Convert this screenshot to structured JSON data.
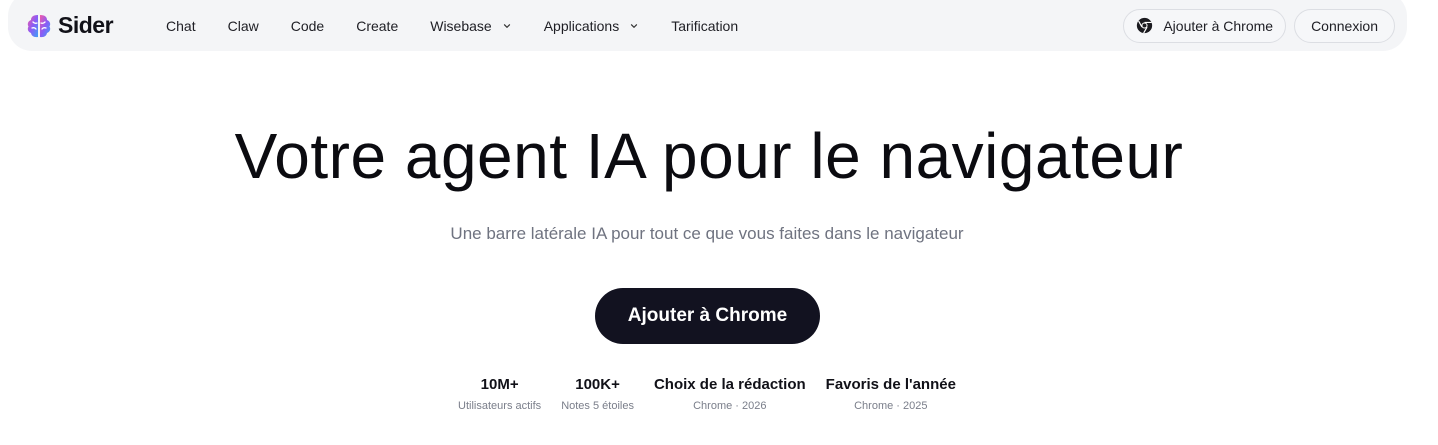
{
  "brand": {
    "name": "Sider",
    "logo_icon": "brain-icon"
  },
  "nav": {
    "items": [
      {
        "label": "Chat",
        "dropdown": false
      },
      {
        "label": "Claw",
        "dropdown": false
      },
      {
        "label": "Code",
        "dropdown": false
      },
      {
        "label": "Create",
        "dropdown": false
      },
      {
        "label": "Wisebase",
        "dropdown": true
      },
      {
        "label": "Applications",
        "dropdown": true
      },
      {
        "label": "Tarification",
        "dropdown": false
      }
    ],
    "add_chrome_label": "Ajouter à Chrome",
    "login_label": "Connexion"
  },
  "hero": {
    "title": "Votre agent IA pour le navigateur",
    "subtitle": "Une barre latérale IA pour tout ce que vous faites dans le navigateur",
    "cta_label": "Ajouter à Chrome"
  },
  "stats": [
    {
      "value": "10M+",
      "label": "Utilisateurs actifs"
    },
    {
      "value": "100K+",
      "label": "Notes 5 étoiles"
    },
    {
      "value": "Choix de la rédaction",
      "label": "Chrome · 2026"
    },
    {
      "value": "Favoris de l'année",
      "label": "Chrome · 2025"
    }
  ],
  "colors": {
    "navbar_bg": "#f4f5f7",
    "cta_bg": "#121220",
    "subtitle": "#6f7380",
    "logo_gradient": [
      "#f25aa8",
      "#8a5cf6",
      "#3ea0f5"
    ]
  }
}
